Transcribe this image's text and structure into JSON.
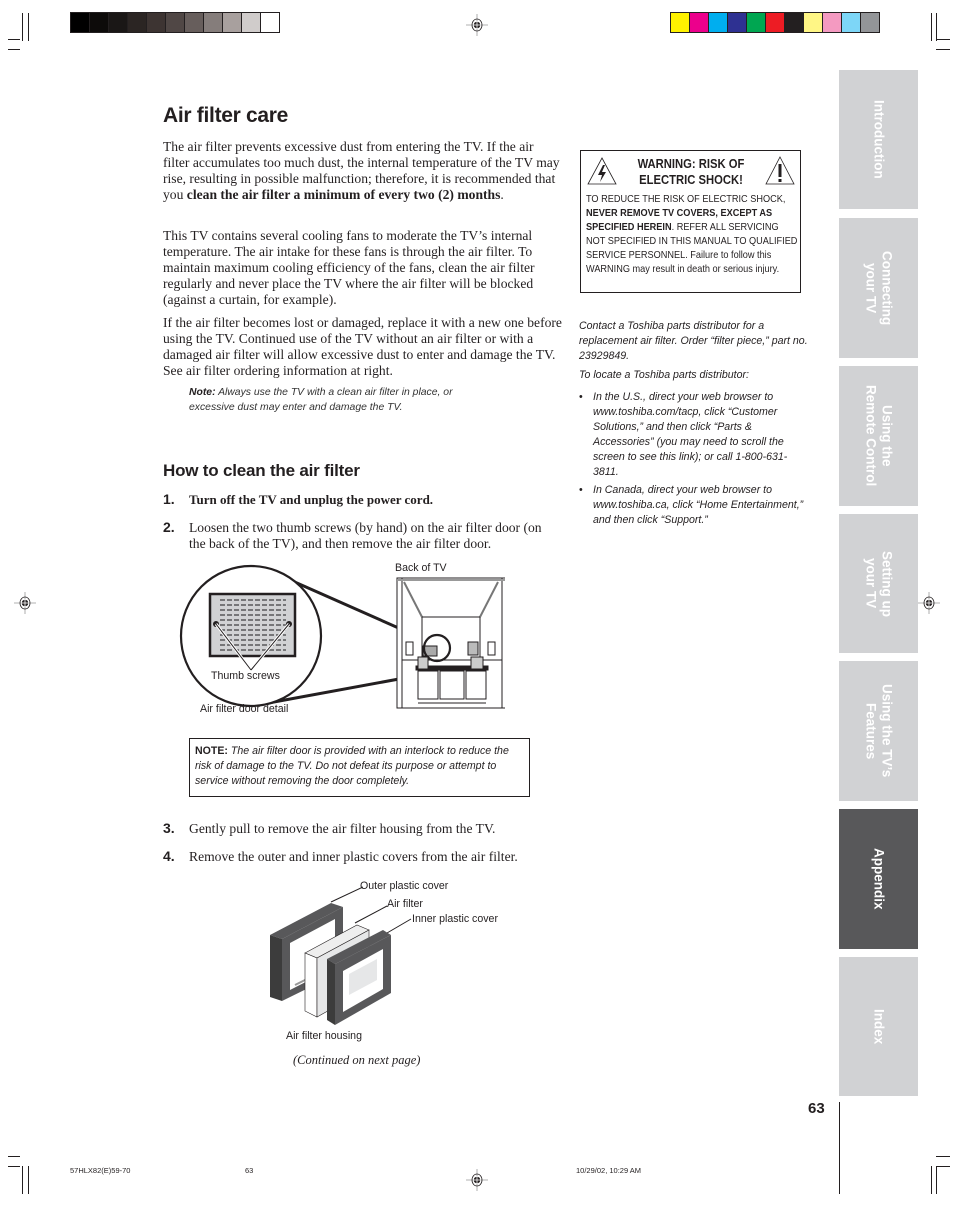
{
  "print_marks": {
    "grayscale_swatches": [
      "#000000",
      "#0d0b0a",
      "#1a1716",
      "#2b2523",
      "#3d3432",
      "#504745",
      "#675e5c",
      "#857d7b",
      "#a8a09e",
      "#d0cccb",
      "#ffffff"
    ],
    "color_swatches": [
      "#fff200",
      "#ec008c",
      "#00aeef",
      "#2e3192",
      "#00a651",
      "#ed1c24",
      "#231f20",
      "#fff685",
      "#f49ac1",
      "#7dd6f7",
      "#939598"
    ]
  },
  "page": {
    "title": "Air filter care",
    "paragraphs": [
      {
        "text": "The air filter prevents excessive dust from entering the TV. If the air filter accumulates too much dust, the internal temperature of the TV may rise, resulting in possible malfunction; therefore, it is recommended that you ",
        "bold": "clean the air filter a minimum of every two (2) months",
        "tail": "."
      },
      {
        "text": "This TV contains several cooling fans to moderate the TV’s internal temperature. The air intake for these fans is through the air filter. To maintain maximum cooling efficiency of the fans, clean the air filter regularly and never place the TV where the air filter will be blocked (against a curtain, for example)."
      },
      {
        "text": "If the air filter becomes lost or damaged, replace it with a new one before using the TV. Continued use of the TV without an air filter or with a damaged air filter will allow excessive dust to enter and damage the TV. See air filter ordering information at right."
      }
    ],
    "note": {
      "label": "Note:",
      "text": " Always use the TV with a clean air filter in place, or excessive dust may enter and damage the TV."
    },
    "section_title": "How to clean the air filter",
    "steps": [
      {
        "num": "1.",
        "text": "Turn off the TV and unplug the power cord."
      },
      {
        "num": "2.",
        "text": "Loosen the two thumb screws (by hand) on the air filter door (on the back of the TV), and then remove the air filter door."
      },
      {
        "num": "3.",
        "text": "Gently pull to remove the air filter housing from the TV."
      },
      {
        "num": "4.",
        "text": "Remove the outer and inner plastic covers from the air filter."
      }
    ],
    "figure1": {
      "back_label": "Back of TV",
      "screws_label": "Thumb screws",
      "detail_label": "Air filter door detail"
    },
    "note_box": {
      "label": "NOTE:",
      "text": " The air filter door is provided with an interlock to reduce the risk of damage to the TV. Do not defeat its purpose or attempt to service without removing the door completely."
    },
    "figure2": {
      "outer": "Outer plastic cover",
      "filter": "Air filter",
      "inner": "Inner plastic cover",
      "housing": "Air filter housing"
    },
    "continued": "(Continued on next page)"
  },
  "warning": {
    "title_line1": "WARNING: RISK OF",
    "title_line2": "ELECTRIC SHOCK!",
    "body_pre": "TO REDUCE THE RISK OF ELECTRIC SHOCK, ",
    "body_bold": "NEVER REMOVE TV COVERS, EXCEPT AS SPECIFIED HEREIN",
    "body_post": ". REFER ALL SERVICING NOT SPECIFIED IN THIS MANUAL TO QUALIFIED SERVICE PERSONNEL. Failure to follow this WARNING may result in death or serious injury.",
    "left_icon": "electric-shock-warning-icon",
    "right_icon": "exclamation-warning-icon"
  },
  "ordering": {
    "contact": "Contact a Toshiba parts distributor for a replacement air filter. Order “filter piece,” part no. 23929849.",
    "locate": "To locate a Toshiba parts distributor:",
    "bullets": [
      "In the U.S., direct your web browser to www.toshiba.com/tacp, click “Customer Solutions,” and then click “Parts & Accessories” (you may need to scroll the screen to see this link); or call 1-800-631-3811.",
      "In Canada, direct your web browser to www.toshiba.ca, click “Home Entertainment,” and then click “Support.”"
    ]
  },
  "tabs": [
    {
      "label": "Introduction",
      "active": false
    },
    {
      "label": "Connecting\nyour TV",
      "active": false
    },
    {
      "label": "Using the\nRemote Control",
      "active": false
    },
    {
      "label": "Setting up\nyour TV",
      "active": false
    },
    {
      "label": "Using the TV’s\nFeatures",
      "active": false
    },
    {
      "label": "Appendix",
      "active": true
    },
    {
      "label": "Index",
      "active": false
    }
  ],
  "page_number": "63",
  "slug": {
    "file": "57HLX82(E)59-70",
    "page": "63",
    "date": "10/29/02, 10:29 AM"
  }
}
